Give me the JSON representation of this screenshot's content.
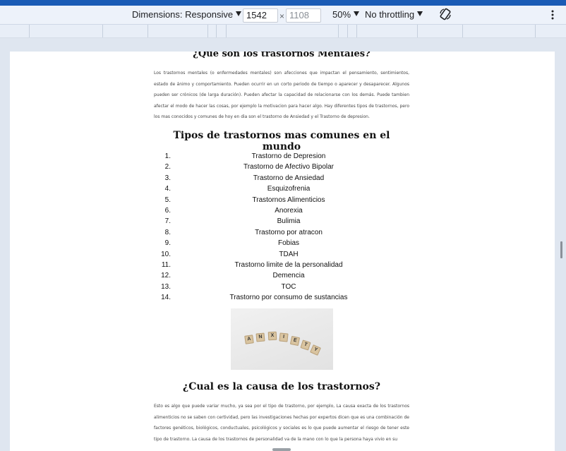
{
  "toolbar": {
    "dimensions_label": "Dimensions: Responsive",
    "width_value": "1542",
    "height_placeholder": "1108",
    "times": "×",
    "zoom": "50%",
    "throttling": "No throttling",
    "rotate_icon": "rotate-icon",
    "more_icon": "more-vert-icon"
  },
  "page": {
    "section1_title": "¿Que son los trastornos Mentales?",
    "section1_text": "Los trastornos mentales (o enfermedades mentales) son afecciones que impactan el pensamiento, sentimientos, estado de ánimo y comportamiento. Pueden ocurrir en un corto periodo de tiempo o aparecer y desaparecer. Algunos pueden ser crónicos (de larga duración). Pueden afectar la capacidad de relacionarse con los demás. Puede tambien afectar el modo de hacer las cosas, por ejemplo la motivacion para hacer algo. Hay diferentes tipos de trastornos, pero los mas conocidos y comunes de hoy en dia son el trastorno de Ansiedad y el Trastorno de depresion.",
    "section2_title": "Tipos de trastornos mas comunes en el mundo",
    "list": [
      {
        "num": "1.",
        "label": "Trastorno de Depresion"
      },
      {
        "num": "2.",
        "label": "Trastorno de Afectivo Bipolar"
      },
      {
        "num": "3.",
        "label": "Trastorno de Ansiedad"
      },
      {
        "num": "4.",
        "label": "Esquizofrenia"
      },
      {
        "num": "5.",
        "label": "Trastornos Alimenticios"
      },
      {
        "num": "6.",
        "label": "Anorexia"
      },
      {
        "num": "7.",
        "label": "Bulimia"
      },
      {
        "num": "8.",
        "label": "Trastorno por atracon"
      },
      {
        "num": "9.",
        "label": "Fobias"
      },
      {
        "num": "10.",
        "label": "TDAH"
      },
      {
        "num": "11.",
        "label": "Trastorno limite de la personalidad"
      },
      {
        "num": "12.",
        "label": "Demencia"
      },
      {
        "num": "13.",
        "label": "TOC"
      },
      {
        "num": "14.",
        "label": "Trastorno por consumo de sustancias"
      }
    ],
    "image_tiles": [
      "A",
      "N",
      "X",
      "I",
      "E",
      "T",
      "Y"
    ],
    "section3_title": "¿Cual es la causa de los trastornos?",
    "section3_text": "Esto es algo que puede variar mucho, ya sea por el tipo de trastorno, por ejemplo, La causa exacta de los trastornos alimenticios no se saben con certividad, pero las investigaciones hechas por expertos dicen que es una combinación de factores genéticos, biológicos, conductuales, psicológicos y sociales es lo que puede aumentar el riesgo de tener este tipo de trastorno. La causa de los trastornos de personalidad va de la mano con lo que la persona haya vivio en su"
  }
}
